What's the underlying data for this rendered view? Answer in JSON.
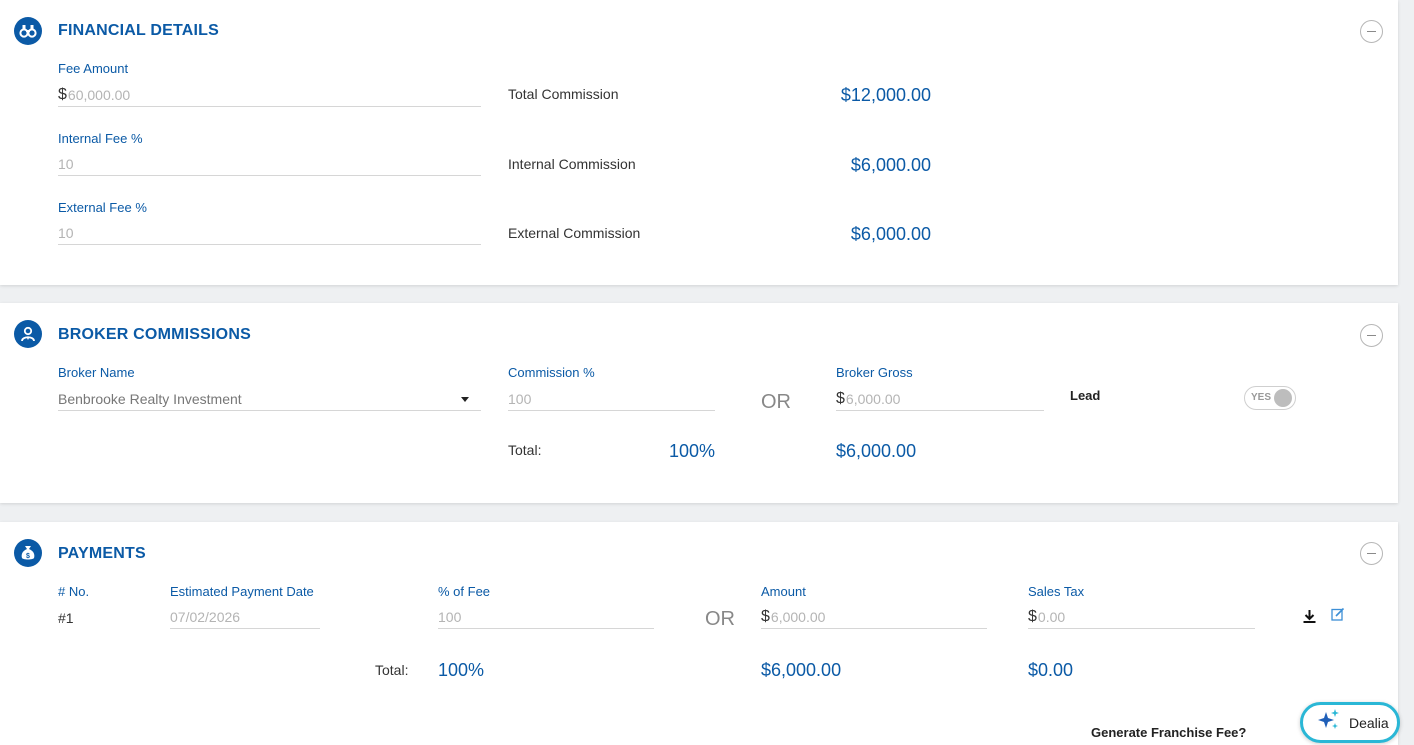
{
  "financial": {
    "title": "FINANCIAL DETAILS",
    "icon": "binoculars-icon",
    "fee_amount_label": "Fee Amount",
    "fee_amount_currency": "$",
    "fee_amount_placeholder": "60,000.00",
    "internal_fee_label": "Internal Fee %",
    "internal_fee_placeholder": "10",
    "external_fee_label": "External Fee %",
    "external_fee_placeholder": "10",
    "total_commission_label": "Total Commission",
    "total_commission_value": "$12,000.00",
    "internal_commission_label": "Internal Commission",
    "internal_commission_value": "$6,000.00",
    "external_commission_label": "External Commission",
    "external_commission_value": "$6,000.00"
  },
  "broker": {
    "title": "BROKER COMMISSIONS",
    "icon": "user-tie-icon",
    "broker_name_label": "Broker Name",
    "broker_name_value": "Benbrooke Realty Investment",
    "commission_pct_label": "Commission %",
    "commission_pct_placeholder": "100",
    "or_text": "OR",
    "broker_gross_label": "Broker Gross",
    "broker_gross_currency": "$",
    "broker_gross_placeholder": "6,000.00",
    "lead_label": "Lead",
    "lead_toggle_text": "YES",
    "total_label": "Total:",
    "total_pct": "100%",
    "total_amount": "$6,000.00"
  },
  "payments": {
    "title": "PAYMENTS",
    "icon": "money-bag-icon",
    "columns": {
      "no": "# No.",
      "date": "Estimated Payment Date",
      "pct": "% of Fee",
      "amount": "Amount",
      "sales_tax": "Sales Tax"
    },
    "rows": [
      {
        "no": "#1",
        "date_placeholder": "07/02/2026",
        "pct_placeholder": "100",
        "amount_currency": "$",
        "amount_placeholder": "6,000.00",
        "tax_currency": "$",
        "tax_placeholder": "0.00"
      }
    ],
    "or_text": "OR",
    "total_label": "Total:",
    "total_pct": "100%",
    "total_amount": "$6,000.00",
    "total_tax": "$0.00",
    "generate_franchise_label": "Generate Franchise Fee?"
  },
  "assistant": {
    "label": "Dealia",
    "icon": "sparkle-icon"
  },
  "colors": {
    "accent": "#0b5aa6",
    "assistant_border": "#2ab7d6"
  }
}
